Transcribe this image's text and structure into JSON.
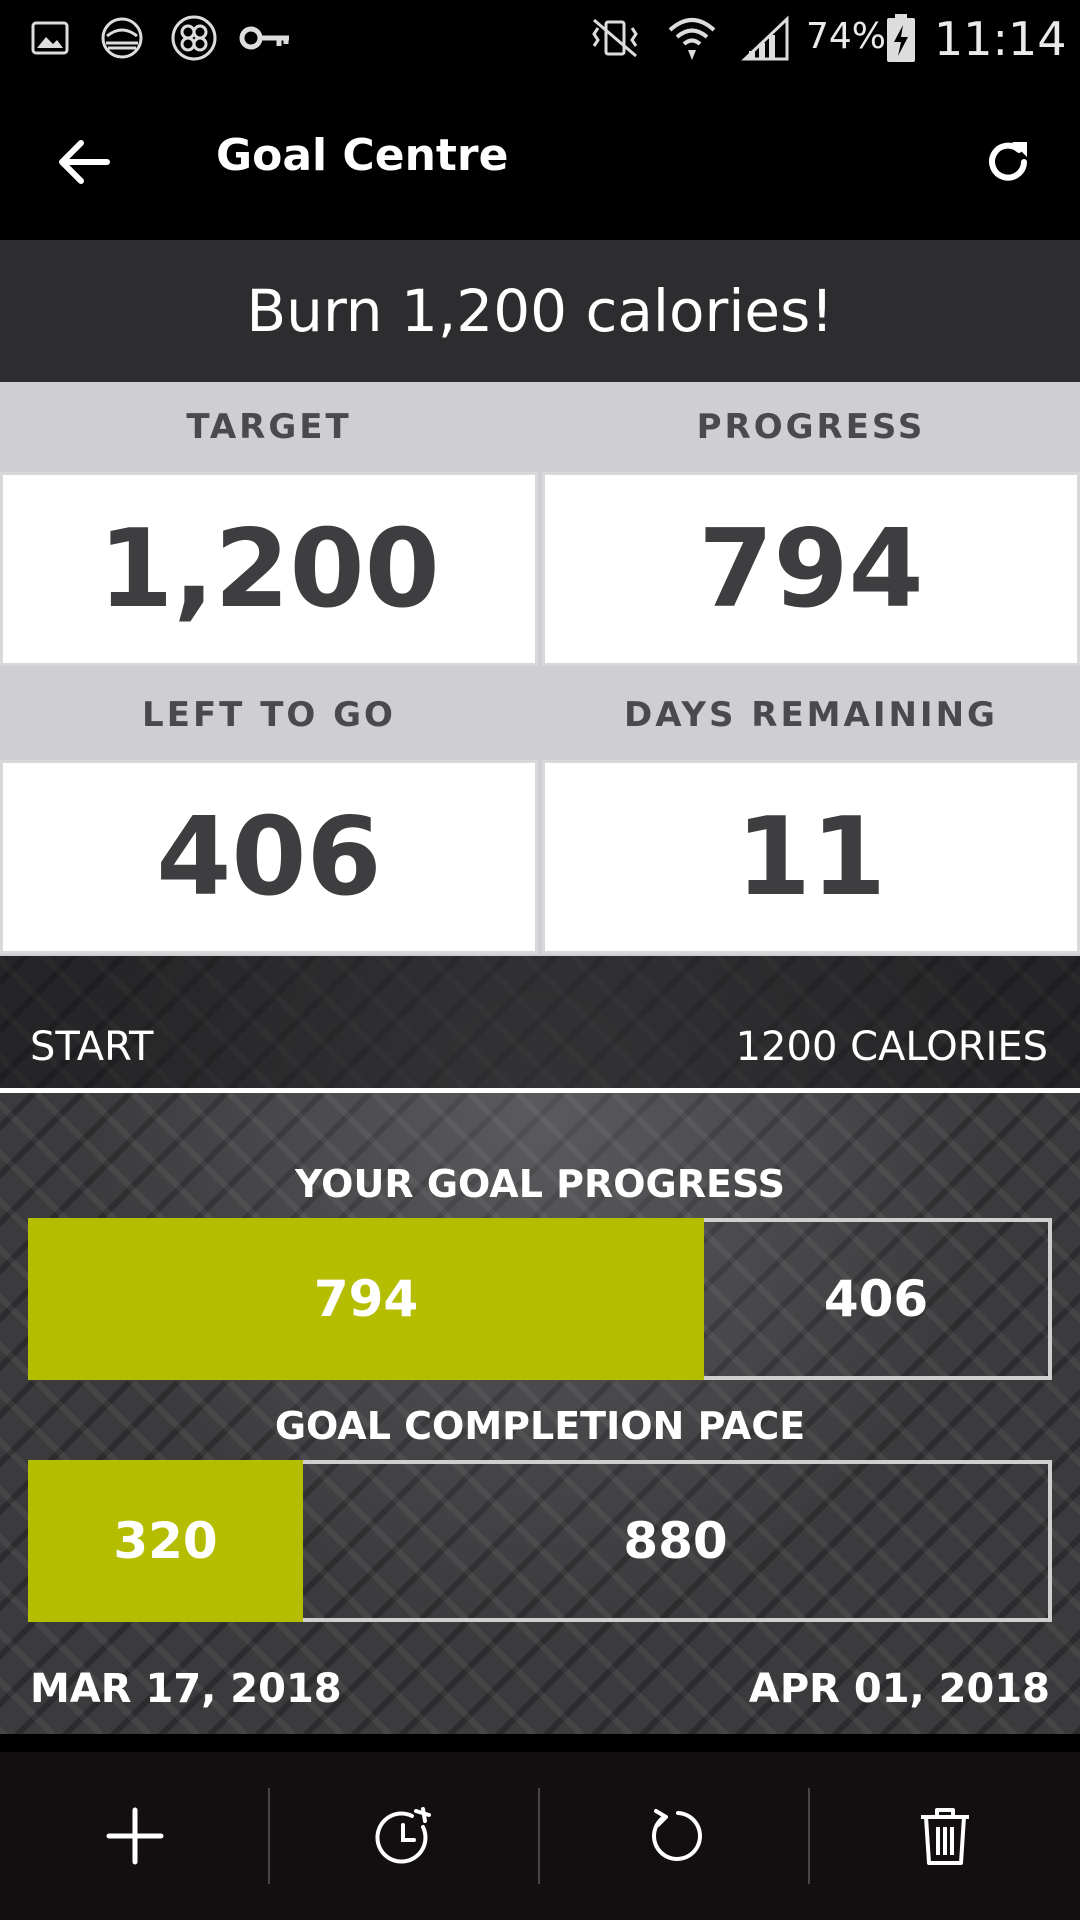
{
  "status_bar": {
    "battery": "74%",
    "time": "11:14",
    "left_icons": [
      "gallery-icon",
      "landscape-icon",
      "pinwheel-icon",
      "key-icon"
    ],
    "right_icons": [
      "vibrate-icon",
      "wifi-icon",
      "signal-icon",
      "battery-charging-icon"
    ]
  },
  "app_bar": {
    "title": "Goal Centre",
    "back_icon": "arrow-left-icon",
    "refresh_icon": "refresh-icon"
  },
  "goal": {
    "heading": "Burn 1,200 calories!"
  },
  "stats": [
    {
      "label": "TARGET",
      "value": "1,200"
    },
    {
      "label": "PROGRESS",
      "value": "794"
    },
    {
      "label": "LEFT TO GO",
      "value": "406"
    },
    {
      "label": "DAYS REMAINING",
      "value": "11"
    }
  ],
  "range": {
    "start_label": "START",
    "end_label": "1200 CALORIES"
  },
  "progress_section": {
    "title": "YOUR GOAL PROGRESS",
    "done_value": "794",
    "left_value": "406",
    "fraction": 0.6617
  },
  "pace_section": {
    "title": "GOAL COMPLETION PACE",
    "done_value": "320",
    "left_value": "880",
    "fraction": 0.2667
  },
  "dates": {
    "start": "MAR 17, 2018",
    "end": "APR 01, 2018"
  },
  "toolbar": {
    "items": [
      "add-icon",
      "timer-icon",
      "reset-icon",
      "trash-icon"
    ]
  },
  "colors": {
    "accent": "#b5bd00",
    "label_bg": "#cfced1",
    "value_text": "#3e3e41",
    "heading_bg": "#2d2d2f",
    "toolbar_bg": "#130e0f"
  }
}
